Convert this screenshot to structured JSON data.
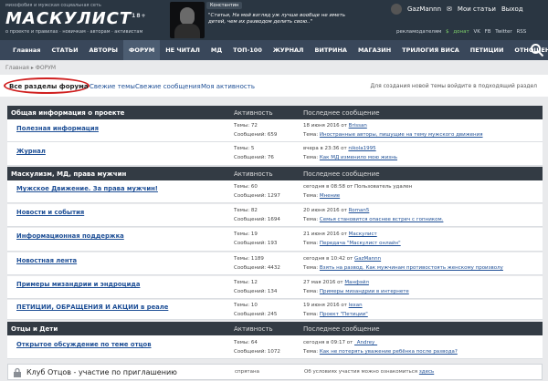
{
  "header": {
    "tagline": "мизофобия и мужская социальная сеть",
    "logo": "МАСКУЛИСТ",
    "age": "18+",
    "links": [
      "о проекте и правилах",
      "новичкам",
      "авторам",
      "активистам"
    ],
    "quote_author": "Константин",
    "quote": "\"Статьи, На мой взгляд уж лучше вообще не иметь детей, чем их разводом делить свою..\"",
    "username": "GazMannn",
    "user_menu": [
      "Мои статьи",
      "Выход"
    ],
    "ad": "рекламодателям",
    "donate": "донат",
    "social": [
      "VK",
      "FB",
      "Twitter",
      "RSS"
    ]
  },
  "nav": {
    "items": [
      "Главная",
      "СТАТЬИ",
      "АВТОРЫ",
      "ФОРУМ",
      "НЕ ЧИТАЛ",
      "МД",
      "ТОП-100",
      "ЖУРНАЛ",
      "ВИТРИНА",
      "МАГАЗИН",
      "ТРИЛОГИЯ ВИСА",
      "ПЕТИЦИИ",
      "ОТНОШЕНИЯ"
    ]
  },
  "breadcrumb": [
    "Главная",
    "ФОРУМ"
  ],
  "tabs": {
    "items": [
      "Все разделы форума",
      "Свежие темы",
      "Свежие сообщения",
      "Моя активность"
    ],
    "note": "Для создания новой темы войдите в подходящий раздел"
  },
  "cols": {
    "activity": "Активность",
    "last": "Последнее сообщение"
  },
  "sections": [
    {
      "title": "Общая информация о проекте"
    },
    {
      "title": "Маскулизм, МД, права мужчин"
    },
    {
      "title": "Отцы и Дети"
    }
  ],
  "rows": [
    {
      "title": "Полезная информация",
      "topics": "Темы: 72",
      "msgs": "Сообщений: 659",
      "when": "18 июня 2016 от",
      "who": "Brissan",
      "sub": "Тема:",
      "link": "Иностранные авторы, пишущие на тему мужского движения"
    },
    {
      "title": "Журнал",
      "topics": "Темы: 5",
      "msgs": "Сообщений: 76",
      "when": "вчера в 23:36 от",
      "who": "nikola1995",
      "sub": "Тема:",
      "link": "Как МД изменило мою жизнь"
    },
    {
      "title": "Мужское Движение. За права мужчин!",
      "topics": "Темы: 60",
      "msgs": "Сообщений: 1297",
      "when": "сегодня в 08:58 от",
      "who": "Пользователь удален",
      "sub": "Тема:",
      "link": "Мнение"
    },
    {
      "title": "Новости и события",
      "topics": "Темы: 82",
      "msgs": "Сообщений: 1694",
      "when": "20 июня 2016 от",
      "who": "Roman5",
      "sub": "Тема:",
      "link": "Семья становится опаснее встреч с гопником."
    },
    {
      "title": "Информационная поддержка",
      "topics": "Темы: 19",
      "msgs": "Сообщений: 193",
      "when": "21 июня 2016 от",
      "who": "Маскулист",
      "sub": "Тема:",
      "link": "Передача \"Маскулист онлайн\""
    },
    {
      "title": "Новостная лента",
      "topics": "Темы: 1189",
      "msgs": "Сообщений: 4432",
      "when": "сегодня в 10:42 от",
      "who": "GazMannn",
      "sub": "Тема:",
      "link": "Взять на развод. Как мужчинам противостоять женскому произволу"
    },
    {
      "title": "Примеры мизандрии и эндроцида",
      "topics": "Темы: 12",
      "msgs": "Сообщений: 134",
      "when": "27 мая 2016 от",
      "who": "Манфэйл",
      "sub": "Тема:",
      "link": "Примеры мизандрии в интернете"
    },
    {
      "title": "ПЕТИЦИИ, ОБРАЩЕНИЯ И АКЦИИ в реале",
      "topics": "Темы: 10",
      "msgs": "Сообщений: 245",
      "when": "19 июня 2016 от",
      "who": "lexan",
      "sub": "Тема:",
      "link": "Проект \"Петиции\""
    },
    {
      "title": "Открытое обсуждение по теме отцов",
      "topics": "Темы: 64",
      "msgs": "Сообщений: 1072",
      "when": "сегодня в 09:17 от",
      "who": "_Andrey_",
      "sub": "Тема:",
      "link": "Как не потерять уважение ребёнка после развода?"
    }
  ],
  "club": {
    "title": "Клуб Отцов - участие по приглашению",
    "hidden": "спрятана",
    "msg": "Об условиях участия можно ознакомиться",
    "link": "здесь"
  }
}
